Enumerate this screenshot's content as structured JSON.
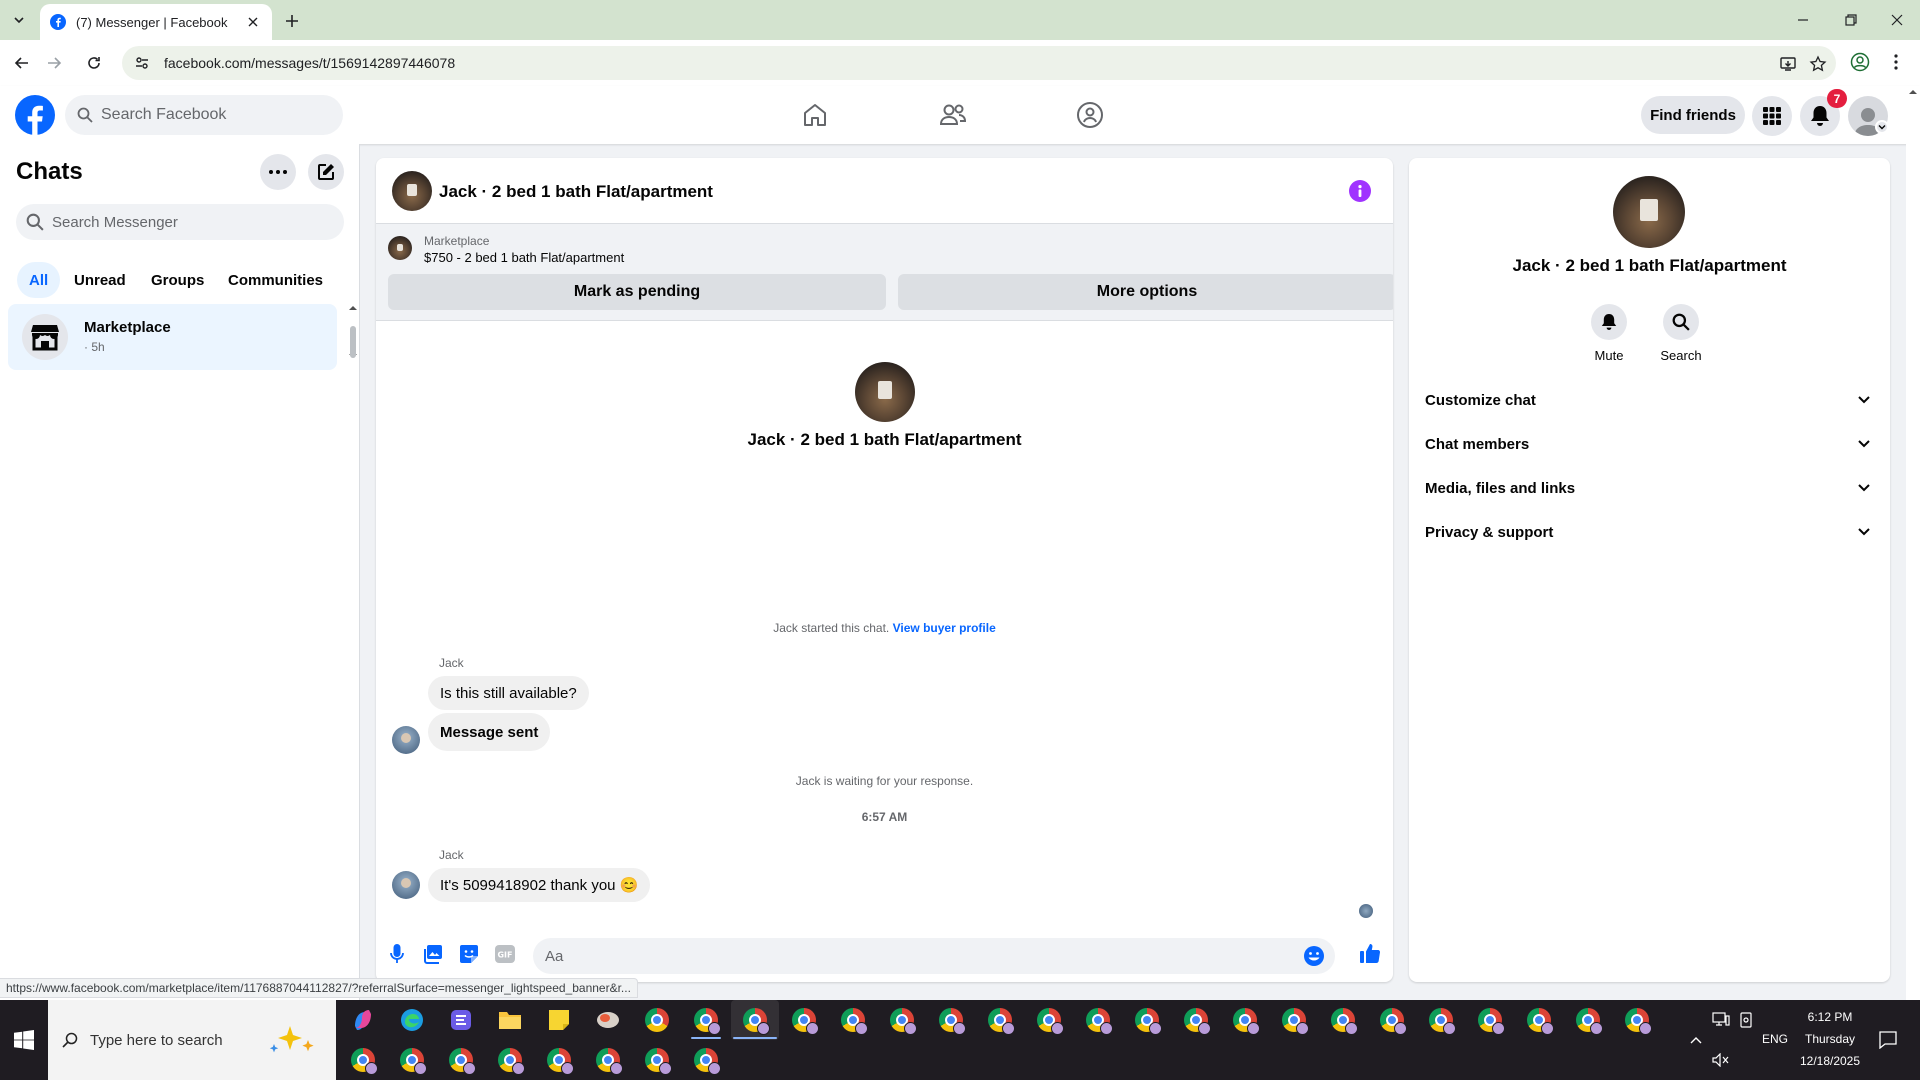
{
  "browser": {
    "tab_title": "(7) Messenger | Facebook",
    "url": "facebook.com/messages/t/1569142897446078",
    "status_url": "https://www.facebook.com/marketplace/item/1176887044112827/?referralSurface=messenger_lightspeed_banner&r..."
  },
  "header": {
    "search_placeholder": "Search Facebook",
    "find_friends": "Find friends",
    "notification_count": "7"
  },
  "sidebar": {
    "title": "Chats",
    "search_placeholder": "Search Messenger",
    "filters": [
      "All",
      "Unread",
      "Groups",
      "Communities"
    ],
    "active_filter": "All",
    "chats": [
      {
        "name": "Marketplace",
        "time": "· 5h"
      }
    ]
  },
  "chat": {
    "title": "Jack · 2 bed 1 bath Flat/apartment",
    "banner": {
      "label": "Marketplace",
      "listing": "$750 - 2 bed 1 bath Flat/apartment",
      "pending_button": "Mark as pending",
      "options_button": "More options"
    },
    "intro_name": "Jack · 2 bed 1 bath Flat/apartment",
    "started_text": "Jack started this chat.",
    "view_profile": "View buyer profile",
    "messages": [
      {
        "sender": "Jack",
        "text": "Is this still available?"
      },
      {
        "text": "Message sent"
      },
      {
        "sender": "Jack",
        "text": "It's 5099418902 thank you 😊"
      }
    ],
    "waiting_text": "Jack is waiting for your response.",
    "timestamp": "6:57 AM",
    "composer_placeholder": "Aa"
  },
  "info_panel": {
    "name": "Jack · 2 bed 1 bath Flat/apartment",
    "actions": [
      {
        "label": "Mute"
      },
      {
        "label": "Search"
      }
    ],
    "sections": [
      "Customize chat",
      "Chat members",
      "Media, files and links",
      "Privacy & support"
    ]
  },
  "taskbar": {
    "search_placeholder": "Type here to search",
    "language": "ENG",
    "time": "6:12 PM",
    "day": "Thursday",
    "date": "12/18/2025"
  },
  "colors": {
    "facebook_blue": "#0866ff",
    "info_purple": "#a033ff",
    "badge_red": "#e41e3f",
    "tabbar_green": "#d3e3cf"
  }
}
